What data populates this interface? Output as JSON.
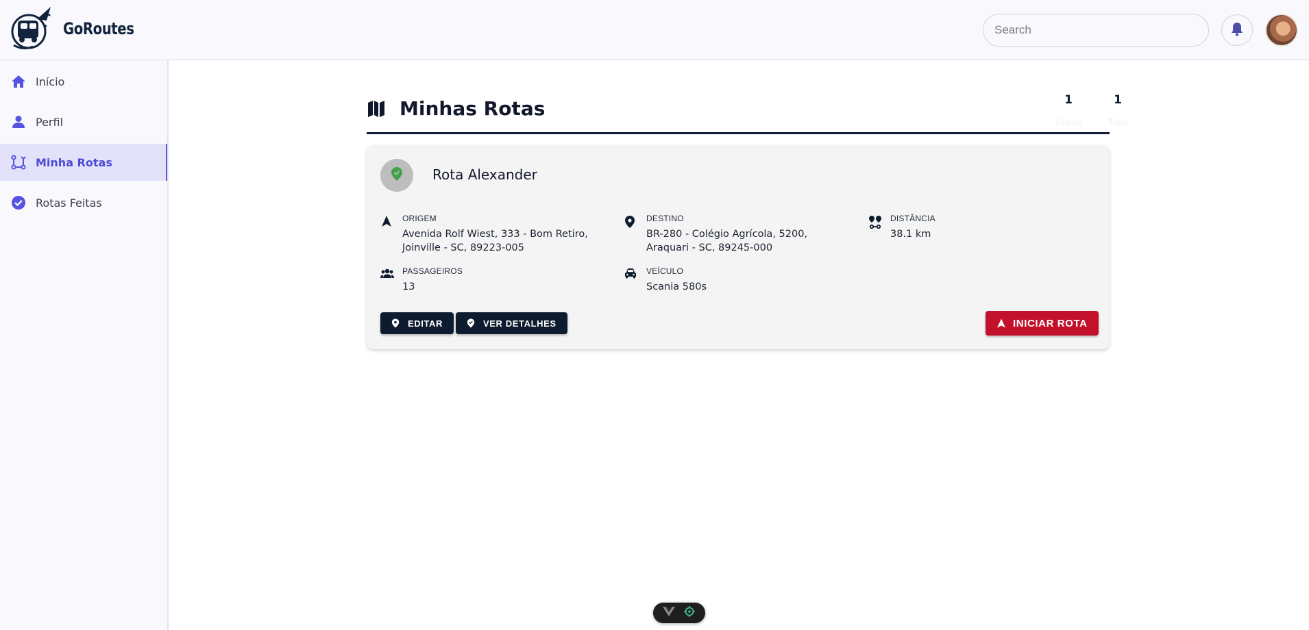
{
  "header": {
    "brand": "GoRoutes",
    "search_placeholder": "Search"
  },
  "sidebar": {
    "items": [
      {
        "label": "Início",
        "icon": "home-icon",
        "active": false
      },
      {
        "label": "Perfil",
        "icon": "person-icon",
        "active": false
      },
      {
        "label": "Minha Rotas",
        "icon": "route-icon",
        "active": true
      },
      {
        "label": "Rotas Feitas",
        "icon": "check-circle-icon",
        "active": false
      }
    ]
  },
  "page": {
    "title": "Minhas Rotas",
    "stats": [
      {
        "value": "1",
        "label": "Ativas"
      },
      {
        "value": "1",
        "label": "Total"
      }
    ]
  },
  "route_card": {
    "title": "Rota Alexander",
    "fields": {
      "origem": {
        "label": "Origem",
        "value": "Avenida Rolf Wiest, 333 - Bom Retiro, Joinville - SC, 89223-005"
      },
      "destino": {
        "label": "Destino",
        "value": "BR-280 - Colégio Agrícola, 5200, Araquari - SC, 89245-000"
      },
      "distancia": {
        "label": "Distância",
        "value": "38.1 km"
      },
      "passageiros": {
        "label": "Passageiros",
        "value": "13"
      },
      "veiculo": {
        "label": "Veículo",
        "value": "Scania 580s"
      }
    },
    "buttons": {
      "edit": "EDITAR",
      "details": "VER DETALHES",
      "start": "INICIAR ROTA"
    }
  },
  "colors": {
    "primary": "#0d1b2e",
    "accent": "#5553e0",
    "danger": "#c4112b",
    "success": "#43a047"
  }
}
